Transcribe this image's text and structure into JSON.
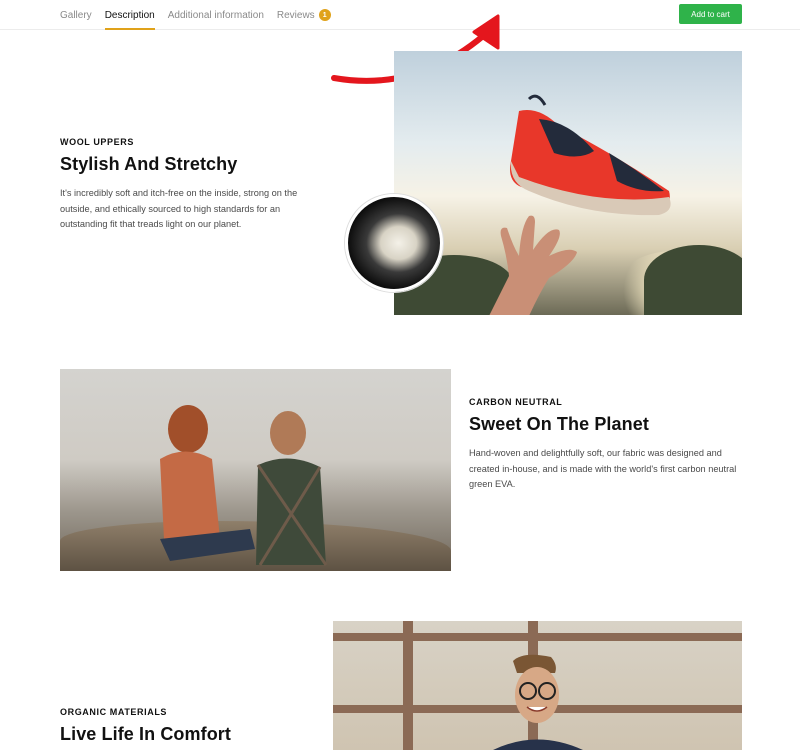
{
  "tabs": [
    {
      "label": "Gallery"
    },
    {
      "label": "Description"
    },
    {
      "label": "Additional information"
    },
    {
      "label": "Reviews",
      "badge": "1"
    }
  ],
  "active_tab": "Description",
  "cart_button": {
    "label": "Add to cart"
  },
  "sections": [
    {
      "eyebrow": "WOOL UPPERS",
      "title": "Stylish And Stretchy",
      "body": "It's incredibly soft and itch-free on the inside, strong on the outside, and ethically sourced to high standards for an outstanding fit that treads light on our planet."
    },
    {
      "eyebrow": "CARBON NEUTRAL",
      "title": "Sweet On The Planet",
      "body": "Hand-woven and delightfully soft, our fabric was designed and created in-house, and is made with the world's first carbon neutral green EVA."
    },
    {
      "eyebrow": "ORGANIC MATERIALS",
      "title": "Live Life In Comfort"
    }
  ],
  "colors": {
    "accent": "#e0a21a",
    "cart": "#2fb34a",
    "arrow": "#e4161d"
  }
}
